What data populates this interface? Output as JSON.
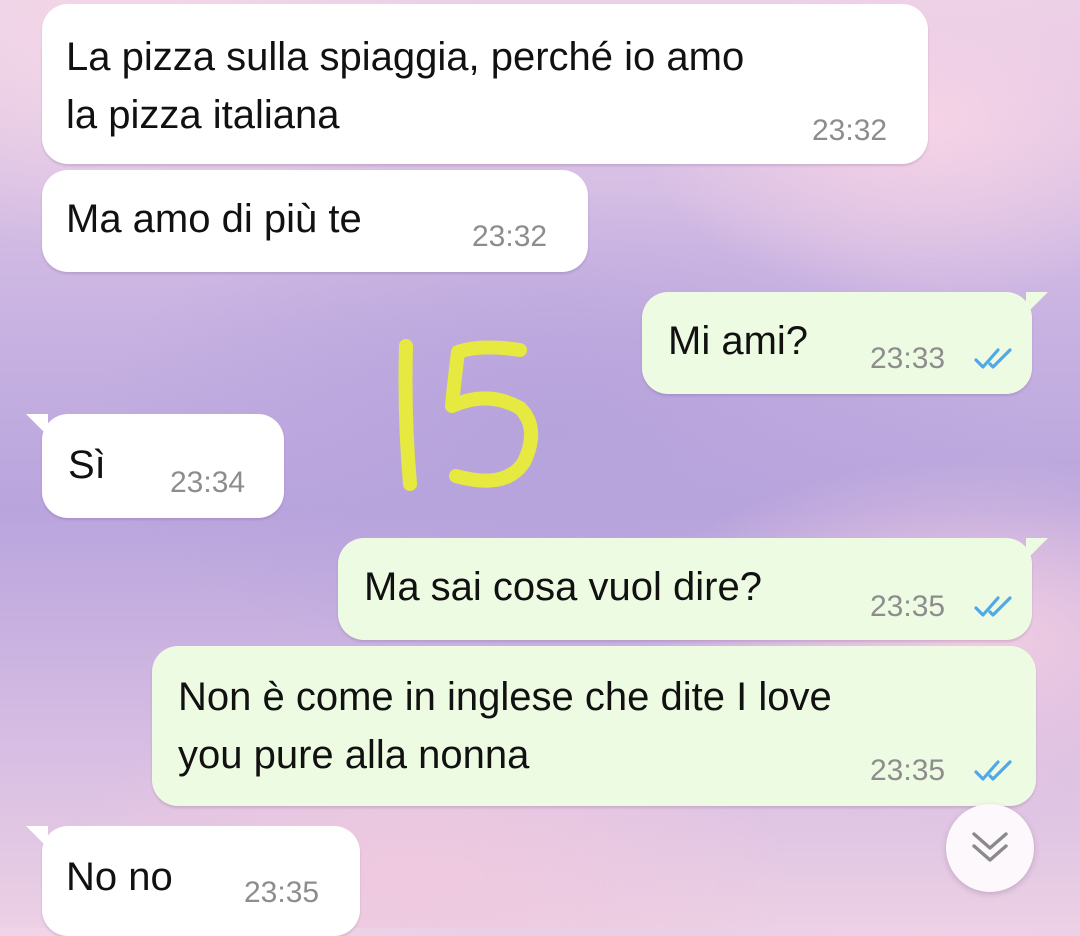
{
  "messages": [
    {
      "direction": "in",
      "text": "La pizza sulla spiaggia, perché io amo\nla pizza italiana",
      "time": "23:32"
    },
    {
      "direction": "in",
      "text": "Ma amo di più te",
      "time": "23:32"
    },
    {
      "direction": "out",
      "text": "Mi ami?",
      "time": "23:33",
      "status": "read"
    },
    {
      "direction": "in",
      "text": "Sì",
      "time": "23:34"
    },
    {
      "direction": "out",
      "text": "Ma sai cosa vuol dire?",
      "time": "23:35",
      "status": "read"
    },
    {
      "direction": "out",
      "text": "Non è come in inglese che dite I love\nyou pure alla nonna",
      "time": "23:35",
      "status": "read"
    },
    {
      "direction": "in",
      "text": "No no",
      "time": "23:35"
    }
  ],
  "overlay_annotation": "15",
  "scroll_button": {
    "icon": "double-chevron-down-icon"
  },
  "colors": {
    "incoming_bubble": "#ffffff",
    "outgoing_bubble": "#eefbe3",
    "read_ticks": "#4fa8e8",
    "timestamp": "#8d8d8d",
    "annotation": "#e6e93f"
  }
}
